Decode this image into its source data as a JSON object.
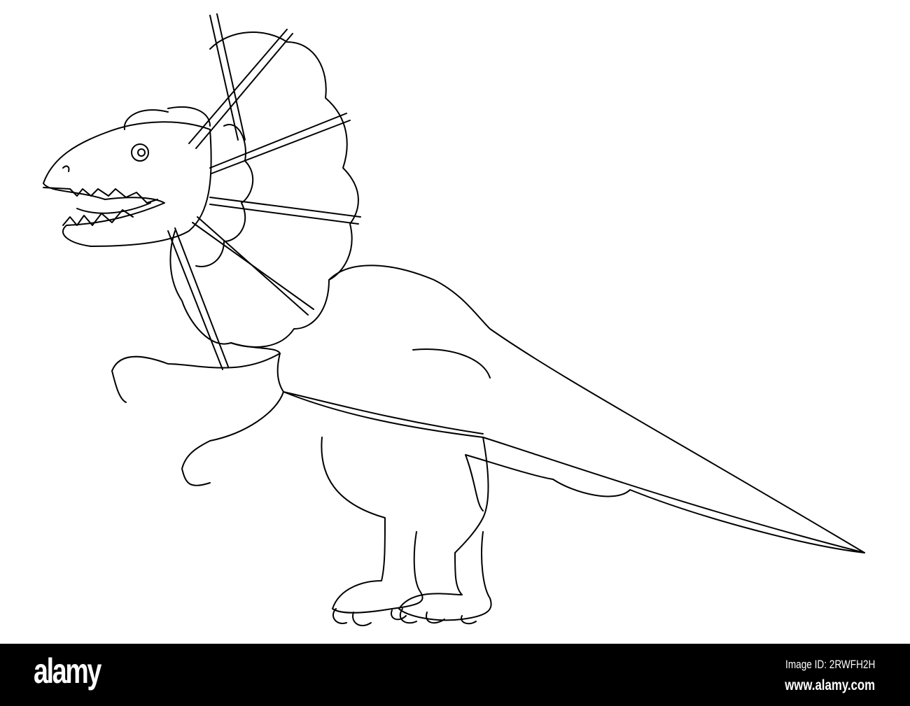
{
  "watermark": {
    "logo": "alamy",
    "image_id": "Image ID: 2RWFH2H",
    "website": "www.alamy.com"
  },
  "colors": {
    "line": "#000000",
    "background": "#ffffff",
    "banner": "#000000"
  }
}
